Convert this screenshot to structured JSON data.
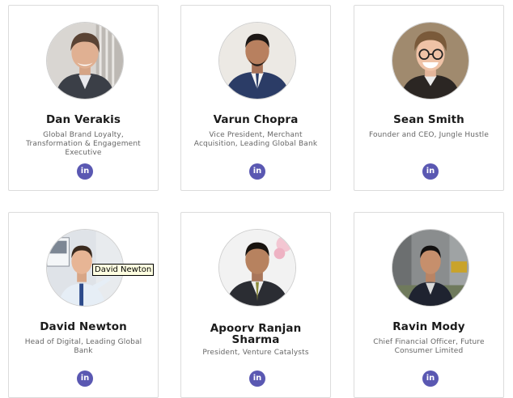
{
  "people": [
    {
      "name": "Dan Verakis",
      "role": "Global Brand Loyalty, Transformation & Engagement Executive",
      "link_icon": "in"
    },
    {
      "name": "Varun Chopra",
      "role": "Vice President, Merchant Acquisition, Leading Global Bank",
      "link_icon": "in"
    },
    {
      "name": "Sean Smith",
      "role": "Founder and CEO, Jungle Hustle",
      "link_icon": "in"
    },
    {
      "name": "David Newton",
      "role": "Head of Digital, Leading Global Bank",
      "link_icon": "in"
    },
    {
      "name": "Apoorv Ranjan Sharma",
      "role": "President, Venture Catalysts",
      "link_icon": "in"
    },
    {
      "name": "Ravin Mody",
      "role": "Chief Financial Officer, Future Consumer Limited",
      "link_icon": "in"
    }
  ],
  "tooltip": {
    "text": "David Newton"
  },
  "colors": {
    "linkedin_badge": "#5a58b2",
    "card_border": "#dcdcdc"
  }
}
